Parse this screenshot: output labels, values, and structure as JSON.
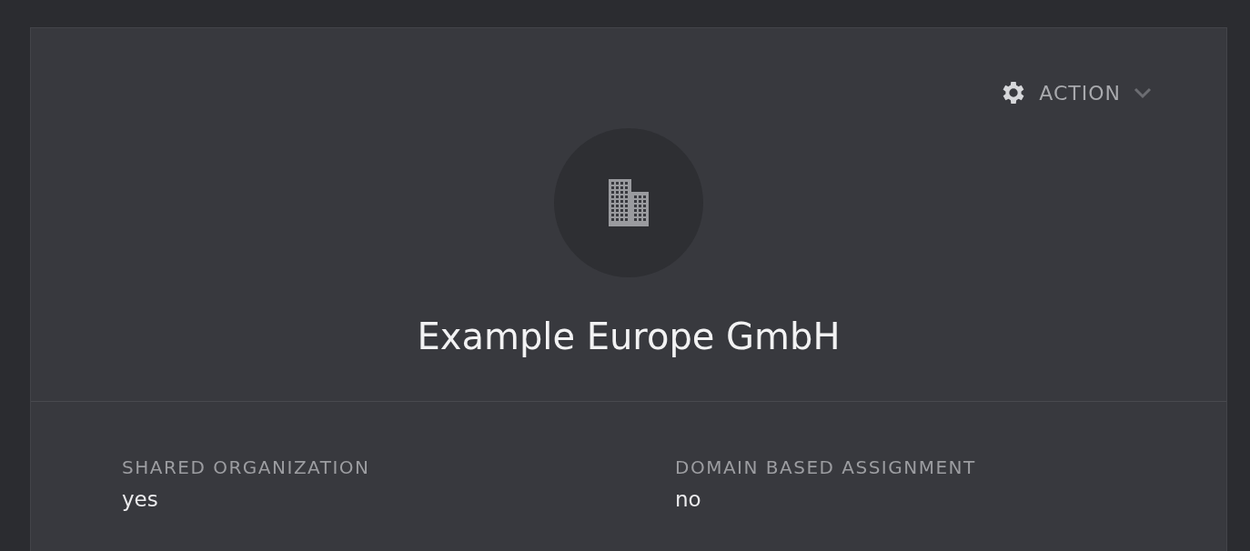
{
  "action": {
    "label": "ACTION"
  },
  "organization": {
    "name": "Example Europe GmbH"
  },
  "attributes": [
    {
      "label": "SHARED ORGANIZATION",
      "value": "yes"
    },
    {
      "label": "DOMAIN BASED ASSIGNMENT",
      "value": "no"
    }
  ]
}
